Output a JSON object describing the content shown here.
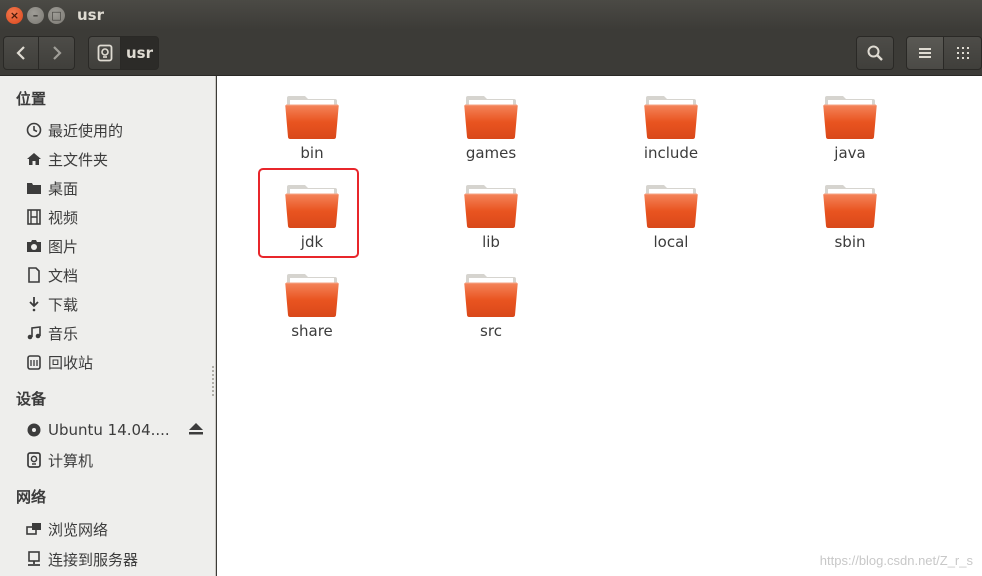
{
  "window": {
    "title": "usr"
  },
  "toolbar": {
    "path_label": "usr",
    "icons": {
      "back": "chevron-left-icon",
      "forward": "chevron-right-icon",
      "drive": "drive-icon",
      "search": "search-icon",
      "list": "list-view-icon",
      "grid": "grid-view-icon"
    }
  },
  "sidebar": {
    "places_header": "位置",
    "places": [
      {
        "label": "最近使用的",
        "icon": "clock-icon"
      },
      {
        "label": "主文件夹",
        "icon": "home-icon"
      },
      {
        "label": "桌面",
        "icon": "folder-icon"
      },
      {
        "label": "视频",
        "icon": "film-icon"
      },
      {
        "label": "图片",
        "icon": "camera-icon"
      },
      {
        "label": "文档",
        "icon": "document-icon"
      },
      {
        "label": "下载",
        "icon": "download-icon"
      },
      {
        "label": "音乐",
        "icon": "music-icon"
      },
      {
        "label": "回收站",
        "icon": "trash-icon"
      }
    ],
    "devices_header": "设备",
    "devices": [
      {
        "label": "Ubuntu 14.04....",
        "icon": "disc-icon"
      },
      {
        "label": "计算机",
        "icon": "drive-icon"
      }
    ],
    "network_header": "网络",
    "network": [
      {
        "label": "浏览网络",
        "icon": "network-icon"
      },
      {
        "label": "连接到服务器",
        "icon": "server-icon"
      }
    ]
  },
  "folders": [
    "bin",
    "games",
    "include",
    "java",
    "jdk",
    "lib",
    "local",
    "sbin",
    "share",
    "src"
  ],
  "selected_folder": "jdk",
  "watermark": "https://blog.csdn.net/Z_r_s",
  "colors": {
    "folder_orange": "#e95420",
    "selection": "#e8262b"
  }
}
